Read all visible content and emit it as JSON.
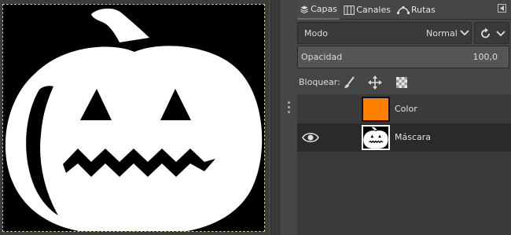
{
  "tabs": [
    {
      "label": "Capas",
      "icon": "layers-icon"
    },
    {
      "label": "Canales",
      "icon": "channels-icon"
    },
    {
      "label": "Rutas",
      "icon": "paths-icon"
    }
  ],
  "mode": {
    "label": "Modo",
    "value": "Normal"
  },
  "opacity": {
    "label": "Opacidad",
    "value": "100,0"
  },
  "lock": {
    "label": "Bloquear:"
  },
  "layers": [
    {
      "name": "Color",
      "visible": false,
      "thumb_color": "#ff7f00"
    },
    {
      "name": "Máscara",
      "visible": true
    }
  ],
  "colors": {
    "accent": "#ff7f00",
    "panel_bg": "#454545"
  }
}
